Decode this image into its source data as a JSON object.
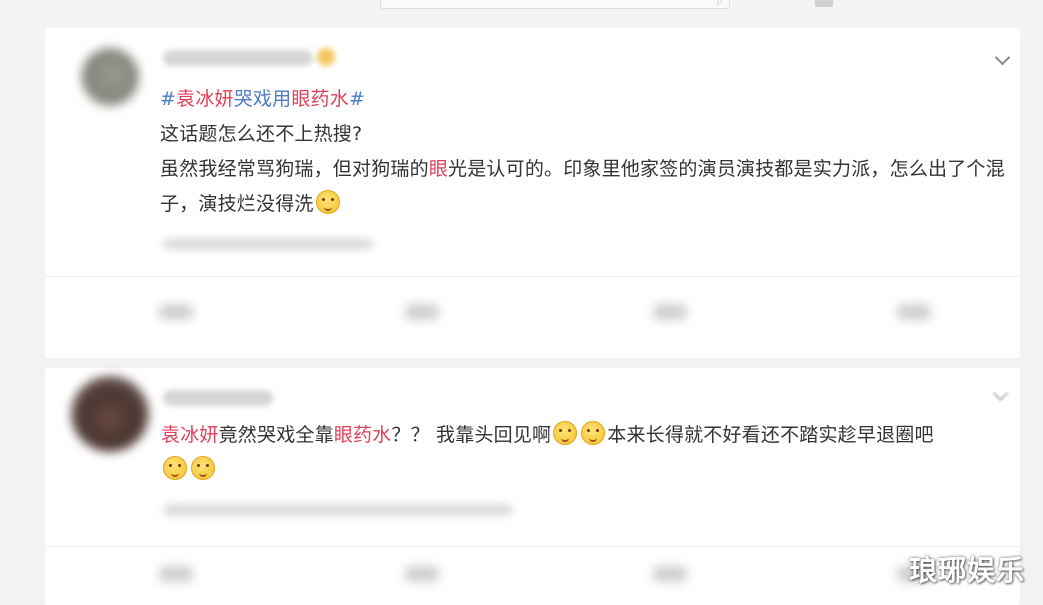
{
  "post1": {
    "topic_open": "#",
    "topic_name": "袁冰妍",
    "topic_mid": "哭戏用",
    "topic_key": "眼药水",
    "topic_close": "#",
    "line1": "这话题怎么还不上热搜?",
    "line2_a": "虽然我经常骂狗瑞，但对狗瑞的",
    "line2_hl": "眼",
    "line2_b": "光是认可的。印象里他家签的演员演技都是实力派，怎么出了个混子，演技烂没得洗"
  },
  "post2": {
    "name": "袁冰妍",
    "mid": "竟然哭戏全靠",
    "key": "眼药水",
    "tail": "？？ 我靠头回见啊",
    "tail2": "本来长得就不好看还不踏实趁早退圈吧"
  },
  "watermark": "琅琊娱乐"
}
